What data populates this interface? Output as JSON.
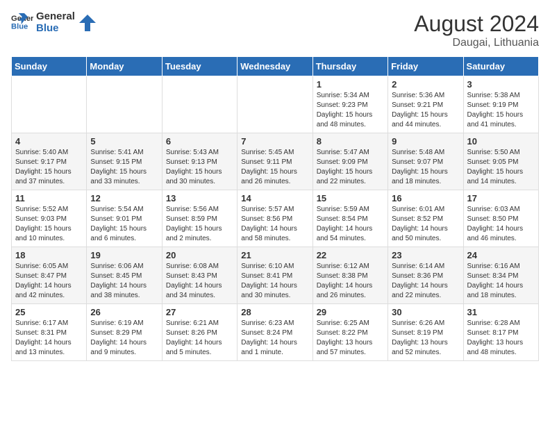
{
  "header": {
    "logo_general": "General",
    "logo_blue": "Blue",
    "month_year": "August 2024",
    "location": "Daugai, Lithuania"
  },
  "weekdays": [
    "Sunday",
    "Monday",
    "Tuesday",
    "Wednesday",
    "Thursday",
    "Friday",
    "Saturday"
  ],
  "weeks": [
    [
      {
        "day": "",
        "info": ""
      },
      {
        "day": "",
        "info": ""
      },
      {
        "day": "",
        "info": ""
      },
      {
        "day": "",
        "info": ""
      },
      {
        "day": "1",
        "info": "Sunrise: 5:34 AM\nSunset: 9:23 PM\nDaylight: 15 hours\nand 48 minutes."
      },
      {
        "day": "2",
        "info": "Sunrise: 5:36 AM\nSunset: 9:21 PM\nDaylight: 15 hours\nand 44 minutes."
      },
      {
        "day": "3",
        "info": "Sunrise: 5:38 AM\nSunset: 9:19 PM\nDaylight: 15 hours\nand 41 minutes."
      }
    ],
    [
      {
        "day": "4",
        "info": "Sunrise: 5:40 AM\nSunset: 9:17 PM\nDaylight: 15 hours\nand 37 minutes."
      },
      {
        "day": "5",
        "info": "Sunrise: 5:41 AM\nSunset: 9:15 PM\nDaylight: 15 hours\nand 33 minutes."
      },
      {
        "day": "6",
        "info": "Sunrise: 5:43 AM\nSunset: 9:13 PM\nDaylight: 15 hours\nand 30 minutes."
      },
      {
        "day": "7",
        "info": "Sunrise: 5:45 AM\nSunset: 9:11 PM\nDaylight: 15 hours\nand 26 minutes."
      },
      {
        "day": "8",
        "info": "Sunrise: 5:47 AM\nSunset: 9:09 PM\nDaylight: 15 hours\nand 22 minutes."
      },
      {
        "day": "9",
        "info": "Sunrise: 5:48 AM\nSunset: 9:07 PM\nDaylight: 15 hours\nand 18 minutes."
      },
      {
        "day": "10",
        "info": "Sunrise: 5:50 AM\nSunset: 9:05 PM\nDaylight: 15 hours\nand 14 minutes."
      }
    ],
    [
      {
        "day": "11",
        "info": "Sunrise: 5:52 AM\nSunset: 9:03 PM\nDaylight: 15 hours\nand 10 minutes."
      },
      {
        "day": "12",
        "info": "Sunrise: 5:54 AM\nSunset: 9:01 PM\nDaylight: 15 hours\nand 6 minutes."
      },
      {
        "day": "13",
        "info": "Sunrise: 5:56 AM\nSunset: 8:59 PM\nDaylight: 15 hours\nand 2 minutes."
      },
      {
        "day": "14",
        "info": "Sunrise: 5:57 AM\nSunset: 8:56 PM\nDaylight: 14 hours\nand 58 minutes."
      },
      {
        "day": "15",
        "info": "Sunrise: 5:59 AM\nSunset: 8:54 PM\nDaylight: 14 hours\nand 54 minutes."
      },
      {
        "day": "16",
        "info": "Sunrise: 6:01 AM\nSunset: 8:52 PM\nDaylight: 14 hours\nand 50 minutes."
      },
      {
        "day": "17",
        "info": "Sunrise: 6:03 AM\nSunset: 8:50 PM\nDaylight: 14 hours\nand 46 minutes."
      }
    ],
    [
      {
        "day": "18",
        "info": "Sunrise: 6:05 AM\nSunset: 8:47 PM\nDaylight: 14 hours\nand 42 minutes."
      },
      {
        "day": "19",
        "info": "Sunrise: 6:06 AM\nSunset: 8:45 PM\nDaylight: 14 hours\nand 38 minutes."
      },
      {
        "day": "20",
        "info": "Sunrise: 6:08 AM\nSunset: 8:43 PM\nDaylight: 14 hours\nand 34 minutes."
      },
      {
        "day": "21",
        "info": "Sunrise: 6:10 AM\nSunset: 8:41 PM\nDaylight: 14 hours\nand 30 minutes."
      },
      {
        "day": "22",
        "info": "Sunrise: 6:12 AM\nSunset: 8:38 PM\nDaylight: 14 hours\nand 26 minutes."
      },
      {
        "day": "23",
        "info": "Sunrise: 6:14 AM\nSunset: 8:36 PM\nDaylight: 14 hours\nand 22 minutes."
      },
      {
        "day": "24",
        "info": "Sunrise: 6:16 AM\nSunset: 8:34 PM\nDaylight: 14 hours\nand 18 minutes."
      }
    ],
    [
      {
        "day": "25",
        "info": "Sunrise: 6:17 AM\nSunset: 8:31 PM\nDaylight: 14 hours\nand 13 minutes."
      },
      {
        "day": "26",
        "info": "Sunrise: 6:19 AM\nSunset: 8:29 PM\nDaylight: 14 hours\nand 9 minutes."
      },
      {
        "day": "27",
        "info": "Sunrise: 6:21 AM\nSunset: 8:26 PM\nDaylight: 14 hours\nand 5 minutes."
      },
      {
        "day": "28",
        "info": "Sunrise: 6:23 AM\nSunset: 8:24 PM\nDaylight: 14 hours\nand 1 minute."
      },
      {
        "day": "29",
        "info": "Sunrise: 6:25 AM\nSunset: 8:22 PM\nDaylight: 13 hours\nand 57 minutes."
      },
      {
        "day": "30",
        "info": "Sunrise: 6:26 AM\nSunset: 8:19 PM\nDaylight: 13 hours\nand 52 minutes."
      },
      {
        "day": "31",
        "info": "Sunrise: 6:28 AM\nSunset: 8:17 PM\nDaylight: 13 hours\nand 48 minutes."
      }
    ]
  ]
}
